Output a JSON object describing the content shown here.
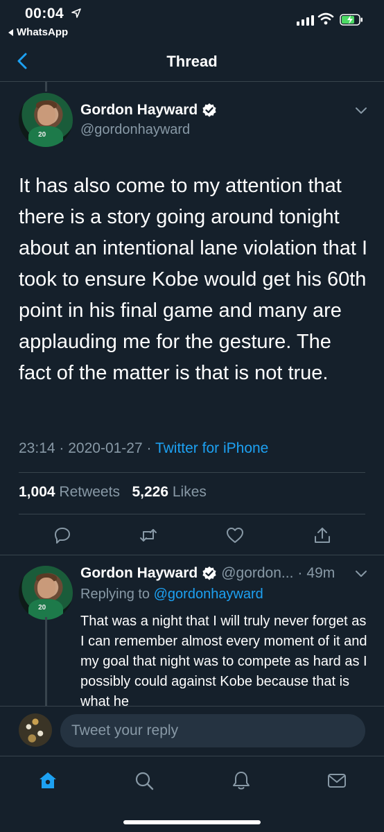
{
  "status_bar": {
    "time": "00:04",
    "back_app": "WhatsApp"
  },
  "nav": {
    "title": "Thread"
  },
  "main_tweet": {
    "author_name": "Gordon Hayward",
    "handle": "@gordonhayward",
    "text": "It has also come to my attention that there is a story going around tonight about an intentional lane violation that I took to ensure Kobe would get his 60th point in his final game and many are applauding me for the gesture. The fact of the matter is that is not true.",
    "time": "23:14",
    "date": "2020-01-27",
    "source": "Twitter for iPhone",
    "retweets_count": "1,004",
    "retweets_label": "Retweets",
    "likes_count": "5,226",
    "likes_label": "Likes"
  },
  "reply_tweet": {
    "author_name": "Gordon Hayward",
    "handle": "@gordon...",
    "age": "49m",
    "replying_label": "Replying to",
    "replying_to": "@gordonhayward",
    "text": "That was a night that I will truly never forget as I can remember almost every moment of it and my goal that night was to compete as hard as I possibly could against Kobe because that is what he"
  },
  "compose": {
    "placeholder": "Tweet your reply"
  },
  "tab_bar": {
    "items": [
      "home-icon",
      "search-icon",
      "notifications-icon",
      "messages-icon"
    ],
    "active": "home-icon"
  },
  "colors": {
    "background": "#15202b",
    "accent": "#1da1f2",
    "secondary_text": "#8899a6",
    "divider": "#38444d"
  }
}
